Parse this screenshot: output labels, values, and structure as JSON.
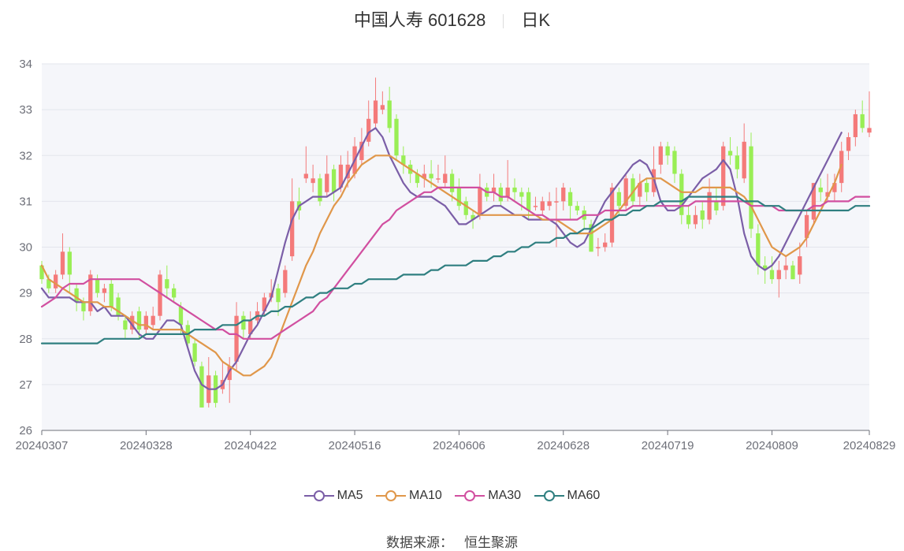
{
  "header": {
    "title": "中国人寿 601628",
    "period": "日K"
  },
  "source": {
    "label": "数据来源：",
    "value": "恒生聚源"
  },
  "colors": {
    "up": "#f47a7a",
    "down": "#99ee55",
    "ma5": "#7b5ea7",
    "ma10": "#e0974a",
    "ma30": "#d14fa0",
    "ma60": "#2f7f80",
    "plot_bg": "#f5f6fa",
    "grid": "#e3e5ec",
    "axis": "#6e7079"
  },
  "chart_data": {
    "type": "candlestick",
    "title": "中国人寿 601628",
    "ylim": [
      26,
      34
    ],
    "y_ticks": [
      "26",
      "27",
      "28",
      "29",
      "30",
      "31",
      "32",
      "33",
      "34"
    ],
    "x_ticks": [
      "20240307",
      "20240328",
      "20240422",
      "20240516",
      "20240606",
      "20240628",
      "20240719",
      "20240809",
      "20240829"
    ],
    "x_tick_index": [
      0,
      15,
      30,
      45,
      60,
      75,
      90,
      105,
      119
    ],
    "grid": true,
    "legend_position": "bottom",
    "candles": [
      [
        29.6,
        29.3,
        29.7,
        29.2
      ],
      [
        29.3,
        29.1,
        29.4,
        29.0
      ],
      [
        29.1,
        29.4,
        29.5,
        29.0
      ],
      [
        29.4,
        29.9,
        30.3,
        29.3
      ],
      [
        29.9,
        29.4,
        30.0,
        29.0
      ],
      [
        29.1,
        28.8,
        29.2,
        28.6
      ],
      [
        28.8,
        28.6,
        28.9,
        28.4
      ],
      [
        28.6,
        29.4,
        29.5,
        28.5
      ],
      [
        29.3,
        29.0,
        29.4,
        28.9
      ],
      [
        29.0,
        29.1,
        29.2,
        28.8
      ],
      [
        29.2,
        28.7,
        29.3,
        28.6
      ],
      [
        28.9,
        28.5,
        29.0,
        28.4
      ],
      [
        28.4,
        28.2,
        28.5,
        28.0
      ],
      [
        28.2,
        28.5,
        28.6,
        28.1
      ],
      [
        28.6,
        28.2,
        28.7,
        28.0
      ],
      [
        28.2,
        28.5,
        28.6,
        28.1
      ],
      [
        28.3,
        28.5,
        28.7,
        28.2
      ],
      [
        28.5,
        29.4,
        29.5,
        28.4
      ],
      [
        29.3,
        29.1,
        29.6,
        28.9
      ],
      [
        29.1,
        28.9,
        29.2,
        28.8
      ],
      [
        28.7,
        28.3,
        28.8,
        28.1
      ],
      [
        28.3,
        27.9,
        28.4,
        27.8
      ],
      [
        27.9,
        27.5,
        28.0,
        27.4
      ],
      [
        27.4,
        26.5,
        27.5,
        26.5
      ],
      [
        26.6,
        27.2,
        27.6,
        26.5
      ],
      [
        27.2,
        26.6,
        27.3,
        26.5
      ],
      [
        26.9,
        27.1,
        27.5,
        26.8
      ],
      [
        27.1,
        27.4,
        27.6,
        26.6
      ],
      [
        27.5,
        28.5,
        28.8,
        27.3
      ],
      [
        28.5,
        28.2,
        28.6,
        28.0
      ],
      [
        28.1,
        28.4,
        28.6,
        28.0
      ],
      [
        28.4,
        28.6,
        28.8,
        28.3
      ],
      [
        28.6,
        28.9,
        29.0,
        28.5
      ],
      [
        28.9,
        29.0,
        29.3,
        28.8
      ],
      [
        29.1,
        28.8,
        29.2,
        28.5
      ],
      [
        29.0,
        29.5,
        29.6,
        28.9
      ],
      [
        29.8,
        31.0,
        31.5,
        29.7
      ],
      [
        31.0,
        30.8,
        31.3,
        30.6
      ],
      [
        31.5,
        31.6,
        32.2,
        31.4
      ],
      [
        31.4,
        31.5,
        31.8,
        31.2
      ],
      [
        31.5,
        31.0,
        31.6,
        30.9
      ],
      [
        31.2,
        31.6,
        32.0,
        31.1
      ],
      [
        31.7,
        31.2,
        31.8,
        31.0
      ],
      [
        31.3,
        31.8,
        32.0,
        31.2
      ],
      [
        31.5,
        31.8,
        32.1,
        31.3
      ],
      [
        31.6,
        32.2,
        32.4,
        31.5
      ],
      [
        31.9,
        32.3,
        32.6,
        31.8
      ],
      [
        32.3,
        32.8,
        33.2,
        32.2
      ],
      [
        32.7,
        33.2,
        33.7,
        32.6
      ],
      [
        33.0,
        33.1,
        33.4,
        32.9
      ],
      [
        33.2,
        32.6,
        33.5,
        32.5
      ],
      [
        32.8,
        32.0,
        32.9,
        31.9
      ],
      [
        32.0,
        31.8,
        32.2,
        31.6
      ],
      [
        31.8,
        31.6,
        31.9,
        31.4
      ],
      [
        31.6,
        31.4,
        31.7,
        31.3
      ],
      [
        31.5,
        31.6,
        31.8,
        31.3
      ],
      [
        31.6,
        31.5,
        31.9,
        31.3
      ],
      [
        31.5,
        31.5,
        31.8,
        31.4
      ],
      [
        31.4,
        31.6,
        32.0,
        31.3
      ],
      [
        31.6,
        31.2,
        31.7,
        31.0
      ],
      [
        31.3,
        30.9,
        31.5,
        30.8
      ],
      [
        31.0,
        30.7,
        31.1,
        30.6
      ],
      [
        30.7,
        30.6,
        30.8,
        30.4
      ],
      [
        30.7,
        31.3,
        31.6,
        30.6
      ],
      [
        31.3,
        31.1,
        31.4,
        31.0
      ],
      [
        31.2,
        31.3,
        31.6,
        31.0
      ],
      [
        31.3,
        31.0,
        31.4,
        30.9
      ],
      [
        31.1,
        31.3,
        31.9,
        31.0
      ],
      [
        31.3,
        31.2,
        31.5,
        31.0
      ],
      [
        31.2,
        31.1,
        31.3,
        30.8
      ],
      [
        31.2,
        30.8,
        31.3,
        30.6
      ],
      [
        30.9,
        30.9,
        31.1,
        30.8
      ],
      [
        30.8,
        31.0,
        31.1,
        30.7
      ],
      [
        30.9,
        31.0,
        31.2,
        30.8
      ],
      [
        31.0,
        31.0,
        31.3,
        30.0
      ],
      [
        31.0,
        31.3,
        31.4,
        30.8
      ],
      [
        31.2,
        30.9,
        31.3,
        30.6
      ],
      [
        30.9,
        30.8,
        31.0,
        30.7
      ],
      [
        30.8,
        30.6,
        30.9,
        30.4
      ],
      [
        30.5,
        29.9,
        30.6,
        29.9
      ],
      [
        30.0,
        30.0,
        30.2,
        29.8
      ],
      [
        30.0,
        30.1,
        30.3,
        29.9
      ],
      [
        30.1,
        31.3,
        31.4,
        30.0
      ],
      [
        31.2,
        30.9,
        31.3,
        30.7
      ],
      [
        30.9,
        31.5,
        31.6,
        30.8
      ],
      [
        31.5,
        31.0,
        31.6,
        30.9
      ],
      [
        31.1,
        31.4,
        31.6,
        30.9
      ],
      [
        31.4,
        31.2,
        31.5,
        31.0
      ],
      [
        31.2,
        31.7,
        32.2,
        31.1
      ],
      [
        31.8,
        32.2,
        32.3,
        31.6
      ],
      [
        32.2,
        32.0,
        32.3,
        31.8
      ],
      [
        32.1,
        31.6,
        32.2,
        31.4
      ],
      [
        31.6,
        30.7,
        31.7,
        30.5
      ],
      [
        30.7,
        30.5,
        30.9,
        30.4
      ],
      [
        30.5,
        30.7,
        30.9,
        30.4
      ],
      [
        30.8,
        30.6,
        31.0,
        30.4
      ],
      [
        30.6,
        31.2,
        31.5,
        30.5
      ],
      [
        31.0,
        30.8,
        31.3,
        30.7
      ],
      [
        30.9,
        32.2,
        32.3,
        30.8
      ],
      [
        32.1,
        32.0,
        32.4,
        31.8
      ],
      [
        32.0,
        31.7,
        32.2,
        31.5
      ],
      [
        31.5,
        32.3,
        32.7,
        31.4
      ],
      [
        32.2,
        30.4,
        32.5,
        30.2
      ],
      [
        30.3,
        29.6,
        30.5,
        29.4
      ],
      [
        29.6,
        29.5,
        29.8,
        29.2
      ],
      [
        29.5,
        29.3,
        29.8,
        29.2
      ],
      [
        29.3,
        29.5,
        29.7,
        28.9
      ],
      [
        29.5,
        29.6,
        29.8,
        29.3
      ],
      [
        29.6,
        29.3,
        29.7,
        29.3
      ],
      [
        29.4,
        29.8,
        30.1,
        29.2
      ],
      [
        30.2,
        30.7,
        30.8,
        30.0
      ],
      [
        30.6,
        31.4,
        31.4,
        30.5
      ],
      [
        31.3,
        31.2,
        31.5,
        31.0
      ],
      [
        31.1,
        31.2,
        31.6,
        31.0
      ],
      [
        31.2,
        31.4,
        31.6,
        31.0
      ],
      [
        31.4,
        32.1,
        32.3,
        31.2
      ],
      [
        32.1,
        32.4,
        32.5,
        31.9
      ],
      [
        32.4,
        32.9,
        33.0,
        32.2
      ],
      [
        32.9,
        32.6,
        33.2,
        32.5
      ],
      [
        32.5,
        32.6,
        33.4,
        32.4
      ]
    ],
    "series": [
      {
        "name": "MA5",
        "key": "ma5",
        "values": [
          29.1,
          28.9,
          28.9,
          28.9,
          28.9,
          28.8,
          28.8,
          28.8,
          28.6,
          28.7,
          28.5,
          28.5,
          28.5,
          28.3,
          28.1,
          28.0,
          28.0,
          28.2,
          28.4,
          28.4,
          28.3,
          27.8,
          27.3,
          27.0,
          26.9,
          26.9,
          27.0,
          27.3,
          27.5,
          27.8,
          28.1,
          28.3,
          28.6,
          28.9,
          29.5,
          30.1,
          30.6,
          30.9,
          31.0,
          31.1,
          31.1,
          31.1,
          31.2,
          31.3,
          31.6,
          31.9,
          32.2,
          32.5,
          32.6,
          32.4,
          32.0,
          31.7,
          31.4,
          31.2,
          31.1,
          31.1,
          31.1,
          31.0,
          30.9,
          30.7,
          30.5,
          30.5,
          30.6,
          30.7,
          30.8,
          30.9,
          30.9,
          30.8,
          30.7,
          30.7,
          30.6,
          30.6,
          30.6,
          30.6,
          30.5,
          30.3,
          30.1,
          30.0,
          30.1,
          30.4,
          30.7,
          31.0,
          31.2,
          31.4,
          31.6,
          31.8,
          31.9,
          31.8,
          31.5,
          31.0,
          30.8,
          30.8,
          30.9,
          31.1,
          31.3,
          31.5,
          31.6,
          31.7,
          31.9,
          31.7,
          31.1,
          30.3,
          29.8,
          29.6,
          29.5,
          29.6,
          29.8,
          30.1,
          30.4,
          30.7,
          31.0,
          31.3,
          31.6,
          31.9,
          32.2,
          32.5
        ]
      },
      {
        "name": "MA10",
        "key": "ma10",
        "values": [
          29.6,
          29.3,
          29.2,
          29.1,
          29.0,
          28.9,
          28.8,
          28.8,
          28.8,
          28.7,
          28.7,
          28.6,
          28.5,
          28.4,
          28.3,
          28.3,
          28.2,
          28.2,
          28.2,
          28.2,
          28.2,
          28.1,
          28.0,
          27.9,
          27.8,
          27.7,
          27.5,
          27.4,
          27.3,
          27.2,
          27.2,
          27.3,
          27.4,
          27.6,
          28.0,
          28.4,
          28.8,
          29.2,
          29.6,
          29.9,
          30.3,
          30.6,
          30.9,
          31.1,
          31.4,
          31.6,
          31.8,
          31.9,
          32.0,
          32.0,
          32.0,
          31.9,
          31.8,
          31.7,
          31.6,
          31.5,
          31.4,
          31.3,
          31.2,
          31.1,
          31.0,
          30.9,
          30.8,
          30.7,
          30.7,
          30.7,
          30.7,
          30.7,
          30.7,
          30.7,
          30.7,
          30.7,
          30.6,
          30.6,
          30.6,
          30.5,
          30.4,
          30.3,
          30.3,
          30.3,
          30.4,
          30.5,
          30.6,
          30.8,
          31.0,
          31.2,
          31.4,
          31.5,
          31.5,
          31.5,
          31.4,
          31.3,
          31.2,
          31.2,
          31.2,
          31.3,
          31.3,
          31.3,
          31.3,
          31.3,
          31.2,
          31.1,
          30.9,
          30.6,
          30.3,
          30.0,
          29.9,
          29.8,
          29.9,
          30.0,
          30.2,
          30.5,
          30.8,
          31.1,
          31.4,
          31.8
        ]
      },
      {
        "name": "MA30",
        "key": "ma30",
        "values": [
          28.7,
          28.8,
          28.9,
          29.1,
          29.2,
          29.2,
          29.2,
          29.3,
          29.3,
          29.3,
          29.3,
          29.3,
          29.3,
          29.3,
          29.3,
          29.2,
          29.1,
          29.0,
          28.9,
          28.8,
          28.7,
          28.6,
          28.5,
          28.4,
          28.3,
          28.2,
          28.2,
          28.1,
          28.1,
          28.0,
          28.0,
          28.0,
          28.0,
          28.0,
          28.1,
          28.2,
          28.3,
          28.4,
          28.5,
          28.6,
          28.8,
          28.9,
          29.1,
          29.3,
          29.5,
          29.7,
          29.9,
          30.1,
          30.3,
          30.5,
          30.6,
          30.8,
          30.9,
          31.0,
          31.1,
          31.2,
          31.2,
          31.3,
          31.3,
          31.3,
          31.3,
          31.3,
          31.3,
          31.3,
          31.2,
          31.2,
          31.1,
          31.1,
          31.0,
          30.9,
          30.8,
          30.7,
          30.7,
          30.6,
          30.6,
          30.6,
          30.6,
          30.6,
          30.7,
          30.7,
          30.7,
          30.8,
          30.8,
          30.8,
          30.8,
          30.9,
          30.9,
          30.9,
          30.9,
          30.9,
          30.9,
          30.9,
          30.9,
          30.9,
          31.0,
          31.0,
          31.0,
          31.0,
          31.0,
          31.0,
          31.0,
          31.0,
          30.9,
          30.9,
          30.9,
          30.9,
          30.8,
          30.8,
          30.8,
          30.8,
          30.8,
          30.9,
          30.9,
          31.0,
          31.0,
          31.0,
          31.0,
          31.1,
          31.1,
          31.1
        ]
      },
      {
        "name": "MA60",
        "key": "ma60",
        "values": [
          27.9,
          27.9,
          27.9,
          27.9,
          27.9,
          27.9,
          27.9,
          27.9,
          27.9,
          28.0,
          28.0,
          28.0,
          28.0,
          28.0,
          28.0,
          28.1,
          28.1,
          28.1,
          28.1,
          28.1,
          28.1,
          28.1,
          28.2,
          28.2,
          28.2,
          28.2,
          28.3,
          28.3,
          28.3,
          28.4,
          28.4,
          28.5,
          28.5,
          28.6,
          28.6,
          28.7,
          28.7,
          28.8,
          28.9,
          28.9,
          29.0,
          29.0,
          29.1,
          29.1,
          29.1,
          29.2,
          29.2,
          29.3,
          29.3,
          29.3,
          29.3,
          29.3,
          29.4,
          29.4,
          29.4,
          29.4,
          29.5,
          29.5,
          29.6,
          29.6,
          29.6,
          29.6,
          29.7,
          29.7,
          29.7,
          29.8,
          29.8,
          29.9,
          29.9,
          30.0,
          30.0,
          30.1,
          30.1,
          30.1,
          30.2,
          30.2,
          30.3,
          30.3,
          30.4,
          30.4,
          30.5,
          30.6,
          30.6,
          30.7,
          30.7,
          30.8,
          30.8,
          30.9,
          30.9,
          31.0,
          31.0,
          31.0,
          31.0,
          31.1,
          31.1,
          31.1,
          31.1,
          31.1,
          31.1,
          31.1,
          31.1,
          31.0,
          31.0,
          31.0,
          30.9,
          30.9,
          30.9,
          30.8,
          30.8,
          30.8,
          30.8,
          30.8,
          30.8,
          30.8,
          30.8,
          30.8,
          30.8,
          30.9,
          30.9,
          30.9
        ]
      }
    ]
  }
}
